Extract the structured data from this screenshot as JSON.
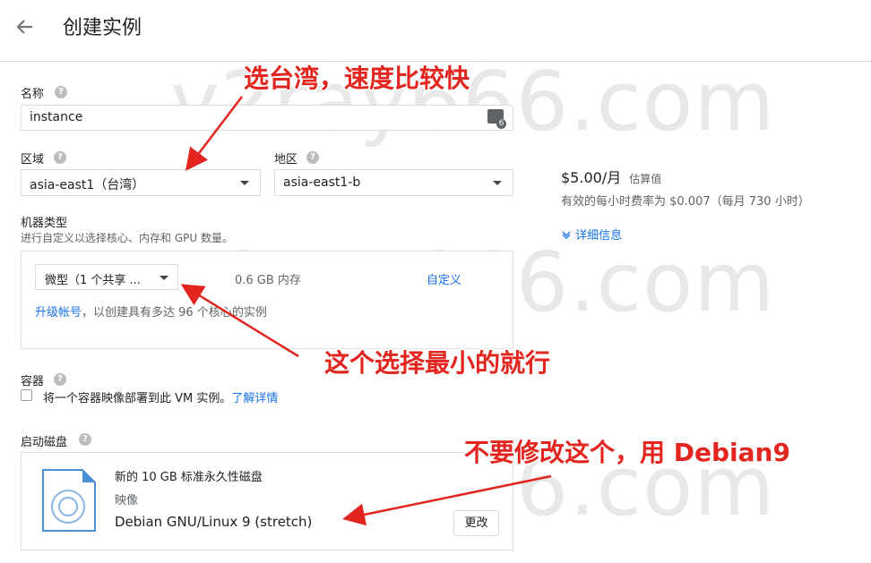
{
  "header": {
    "title": "创建实例"
  },
  "name_field": {
    "label": "名称",
    "value": "instance",
    "badge": "6"
  },
  "region": {
    "label": "区域",
    "value": "asia-east1（台湾）"
  },
  "zone": {
    "label": "地区",
    "value": "asia-east1-b"
  },
  "machine": {
    "label": "机器类型",
    "hint": "进行自定义以选择核心、内存和 GPU 数量。",
    "type_value": "微型（1 个共享 ...",
    "memory": "0.6 GB 内存",
    "customize_link": "自定义",
    "upgrade_link": "升级帐号",
    "upgrade_text": "，以创建具有多达 96 个核心的实例"
  },
  "container": {
    "label": "容器",
    "checkbox_text": "将一个容器映像部署到此 VM 实例。",
    "learn_more": "了解详情"
  },
  "boot_disk": {
    "label": "启动磁盘",
    "desc": "新的 10 GB 标准永久性磁盘",
    "image_label": "映像",
    "image_name": "Debian GNU/Linux 9 (stretch)",
    "change_button": "更改"
  },
  "pricing": {
    "price": "$5.00/月",
    "estimate": "估算值",
    "hourly": "有效的每小时费率为 $0.007（每月 730 小时）",
    "details_link": "详细信息"
  },
  "annotations": {
    "a1": "选台湾，速度比较快",
    "a2": "这个选择最小的就行",
    "a3": "不要修改这个，用 Debian9"
  },
  "watermark": {
    "text1": "v2ray666.com",
    "text2": "v2ray666.com",
    "text3": "v2ray666.com"
  },
  "colors": {
    "accent": "#1a73e8",
    "annotation": "#e2261f",
    "border": "#dadce0"
  }
}
